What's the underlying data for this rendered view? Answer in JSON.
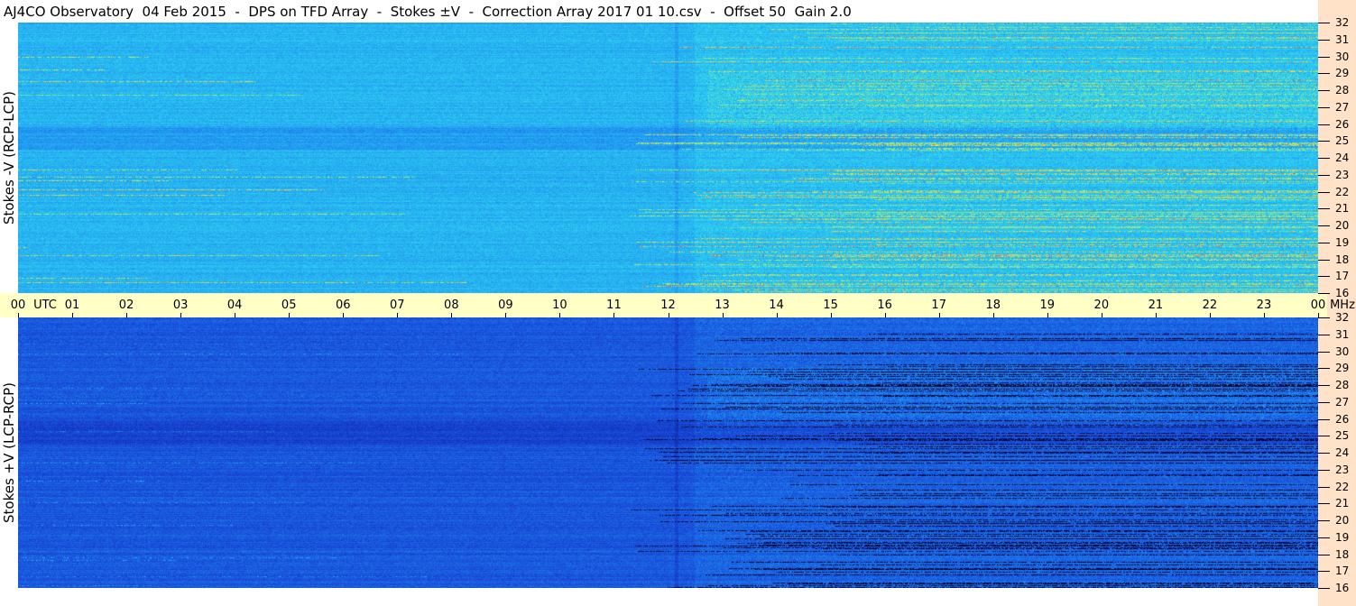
{
  "title": "AJ4CO Observatory  04 Feb 2015  -  DPS on TFD Array  -  Stokes ±V  -  Correction Array 2017 01 10.csv  -  Offset 50  Gain 2.0",
  "chart_data": [
    {
      "type": "heatmap",
      "panel": "top",
      "ylabel": "Stokes -V (RCP-LCP)",
      "x_ticks": [
        "00",
        "01",
        "02",
        "03",
        "04",
        "05",
        "06",
        "07",
        "08",
        "09",
        "10",
        "11",
        "12",
        "13",
        "14",
        "15",
        "16",
        "17",
        "18",
        "19",
        "20",
        "21",
        "22",
        "23",
        "00"
      ],
      "y_ticks": [
        "32",
        "31",
        "30",
        "29",
        "28",
        "27",
        "26",
        "25",
        "24",
        "23",
        "22",
        "21",
        "20",
        "19",
        "18",
        "17",
        "16"
      ],
      "xlim": [
        0,
        24
      ],
      "ylim": [
        16,
        32
      ],
      "colormap": [
        "#0a1a90",
        "#1848d8",
        "#1f8ff0",
        "#2fd6f0",
        "#b6f060",
        "#ffd23a",
        "#ff4a4a"
      ]
    },
    {
      "type": "heatmap",
      "panel": "bottom",
      "ylabel": "Stokes +V (LCP-RCP)",
      "x_ticks": [
        "00",
        "01",
        "02",
        "03",
        "04",
        "05",
        "06",
        "07",
        "08",
        "09",
        "10",
        "11",
        "12",
        "13",
        "14",
        "15",
        "16",
        "17",
        "18",
        "19",
        "20",
        "21",
        "22",
        "23",
        "00"
      ],
      "y_ticks": [
        "32",
        "31",
        "30",
        "29",
        "28",
        "27",
        "26",
        "25",
        "24",
        "23",
        "22",
        "21",
        "20",
        "19",
        "18",
        "17",
        "16"
      ],
      "xlim": [
        0,
        24
      ],
      "ylim": [
        16,
        32
      ],
      "colormap": [
        "#000010",
        "#0a1a90",
        "#1848d8",
        "#1f8ff0",
        "#2fd6f0",
        "#b6f060",
        "#ffd23a"
      ]
    }
  ],
  "time_axis": {
    "unit_label": "UTC",
    "labels": [
      "00",
      "01",
      "02",
      "03",
      "04",
      "05",
      "06",
      "07",
      "08",
      "09",
      "10",
      "11",
      "12",
      "13",
      "14",
      "15",
      "16",
      "17",
      "18",
      "19",
      "20",
      "21",
      "22",
      "23",
      "00"
    ]
  },
  "freq_axis": {
    "unit_label": "MHz"
  },
  "colors": {
    "time_bar": "#ffffc6",
    "freq_strip": "#ffe2c8"
  }
}
